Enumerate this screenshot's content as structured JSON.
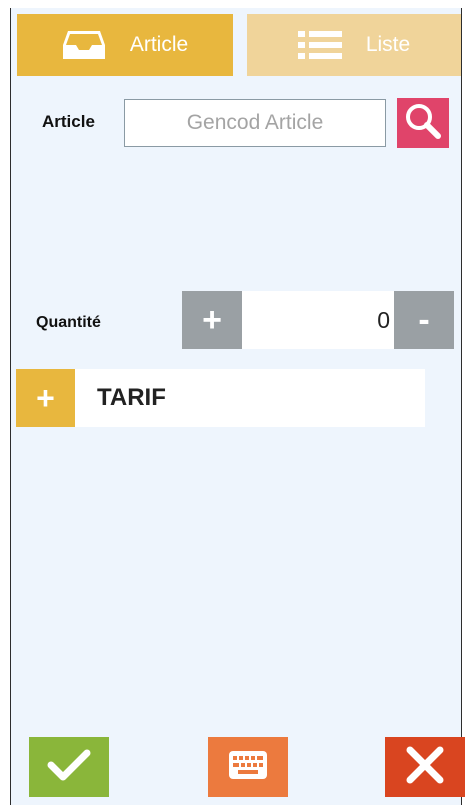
{
  "tabs": {
    "article": {
      "label": "Article",
      "icon": "inbox-tray-icon",
      "color": "#e8b73e"
    },
    "liste": {
      "label": "Liste",
      "icon": "list-icon",
      "color": "#f0d49a"
    }
  },
  "article_form": {
    "label": "Article",
    "placeholder": "Gencod Article",
    "value": "",
    "search_icon": "search-icon",
    "search_color": "#e0446a"
  },
  "quantity": {
    "label": "Quantité",
    "value": "0",
    "plus_label": "+",
    "minus_label": "-"
  },
  "tarif": {
    "plus_label": "+",
    "label": "TARIF"
  },
  "bottom_bar": {
    "validate_icon": "check-icon",
    "validate_color": "#8ab63a",
    "keyboard_icon": "keyboard-icon",
    "keyboard_color": "#ec7a3e",
    "cancel_icon": "close-icon",
    "cancel_color": "#d94520"
  },
  "colors": {
    "background": "#eef5fd",
    "accent": "#e8b73e",
    "button_grey": "#9aa0a4"
  }
}
